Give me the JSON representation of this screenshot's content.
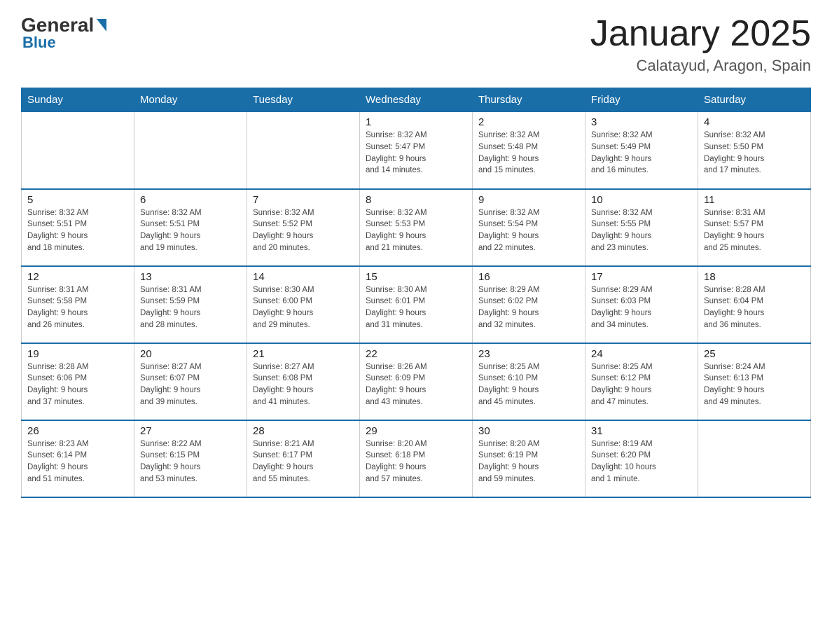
{
  "logo": {
    "general_text": "General",
    "blue_text": "Blue"
  },
  "title": "January 2025",
  "location": "Calatayud, Aragon, Spain",
  "days_of_week": [
    "Sunday",
    "Monday",
    "Tuesday",
    "Wednesday",
    "Thursday",
    "Friday",
    "Saturday"
  ],
  "weeks": [
    [
      {
        "day": "",
        "info": ""
      },
      {
        "day": "",
        "info": ""
      },
      {
        "day": "",
        "info": ""
      },
      {
        "day": "1",
        "info": "Sunrise: 8:32 AM\nSunset: 5:47 PM\nDaylight: 9 hours\nand 14 minutes."
      },
      {
        "day": "2",
        "info": "Sunrise: 8:32 AM\nSunset: 5:48 PM\nDaylight: 9 hours\nand 15 minutes."
      },
      {
        "day": "3",
        "info": "Sunrise: 8:32 AM\nSunset: 5:49 PM\nDaylight: 9 hours\nand 16 minutes."
      },
      {
        "day": "4",
        "info": "Sunrise: 8:32 AM\nSunset: 5:50 PM\nDaylight: 9 hours\nand 17 minutes."
      }
    ],
    [
      {
        "day": "5",
        "info": "Sunrise: 8:32 AM\nSunset: 5:51 PM\nDaylight: 9 hours\nand 18 minutes."
      },
      {
        "day": "6",
        "info": "Sunrise: 8:32 AM\nSunset: 5:51 PM\nDaylight: 9 hours\nand 19 minutes."
      },
      {
        "day": "7",
        "info": "Sunrise: 8:32 AM\nSunset: 5:52 PM\nDaylight: 9 hours\nand 20 minutes."
      },
      {
        "day": "8",
        "info": "Sunrise: 8:32 AM\nSunset: 5:53 PM\nDaylight: 9 hours\nand 21 minutes."
      },
      {
        "day": "9",
        "info": "Sunrise: 8:32 AM\nSunset: 5:54 PM\nDaylight: 9 hours\nand 22 minutes."
      },
      {
        "day": "10",
        "info": "Sunrise: 8:32 AM\nSunset: 5:55 PM\nDaylight: 9 hours\nand 23 minutes."
      },
      {
        "day": "11",
        "info": "Sunrise: 8:31 AM\nSunset: 5:57 PM\nDaylight: 9 hours\nand 25 minutes."
      }
    ],
    [
      {
        "day": "12",
        "info": "Sunrise: 8:31 AM\nSunset: 5:58 PM\nDaylight: 9 hours\nand 26 minutes."
      },
      {
        "day": "13",
        "info": "Sunrise: 8:31 AM\nSunset: 5:59 PM\nDaylight: 9 hours\nand 28 minutes."
      },
      {
        "day": "14",
        "info": "Sunrise: 8:30 AM\nSunset: 6:00 PM\nDaylight: 9 hours\nand 29 minutes."
      },
      {
        "day": "15",
        "info": "Sunrise: 8:30 AM\nSunset: 6:01 PM\nDaylight: 9 hours\nand 31 minutes."
      },
      {
        "day": "16",
        "info": "Sunrise: 8:29 AM\nSunset: 6:02 PM\nDaylight: 9 hours\nand 32 minutes."
      },
      {
        "day": "17",
        "info": "Sunrise: 8:29 AM\nSunset: 6:03 PM\nDaylight: 9 hours\nand 34 minutes."
      },
      {
        "day": "18",
        "info": "Sunrise: 8:28 AM\nSunset: 6:04 PM\nDaylight: 9 hours\nand 36 minutes."
      }
    ],
    [
      {
        "day": "19",
        "info": "Sunrise: 8:28 AM\nSunset: 6:06 PM\nDaylight: 9 hours\nand 37 minutes."
      },
      {
        "day": "20",
        "info": "Sunrise: 8:27 AM\nSunset: 6:07 PM\nDaylight: 9 hours\nand 39 minutes."
      },
      {
        "day": "21",
        "info": "Sunrise: 8:27 AM\nSunset: 6:08 PM\nDaylight: 9 hours\nand 41 minutes."
      },
      {
        "day": "22",
        "info": "Sunrise: 8:26 AM\nSunset: 6:09 PM\nDaylight: 9 hours\nand 43 minutes."
      },
      {
        "day": "23",
        "info": "Sunrise: 8:25 AM\nSunset: 6:10 PM\nDaylight: 9 hours\nand 45 minutes."
      },
      {
        "day": "24",
        "info": "Sunrise: 8:25 AM\nSunset: 6:12 PM\nDaylight: 9 hours\nand 47 minutes."
      },
      {
        "day": "25",
        "info": "Sunrise: 8:24 AM\nSunset: 6:13 PM\nDaylight: 9 hours\nand 49 minutes."
      }
    ],
    [
      {
        "day": "26",
        "info": "Sunrise: 8:23 AM\nSunset: 6:14 PM\nDaylight: 9 hours\nand 51 minutes."
      },
      {
        "day": "27",
        "info": "Sunrise: 8:22 AM\nSunset: 6:15 PM\nDaylight: 9 hours\nand 53 minutes."
      },
      {
        "day": "28",
        "info": "Sunrise: 8:21 AM\nSunset: 6:17 PM\nDaylight: 9 hours\nand 55 minutes."
      },
      {
        "day": "29",
        "info": "Sunrise: 8:20 AM\nSunset: 6:18 PM\nDaylight: 9 hours\nand 57 minutes."
      },
      {
        "day": "30",
        "info": "Sunrise: 8:20 AM\nSunset: 6:19 PM\nDaylight: 9 hours\nand 59 minutes."
      },
      {
        "day": "31",
        "info": "Sunrise: 8:19 AM\nSunset: 6:20 PM\nDaylight: 10 hours\nand 1 minute."
      },
      {
        "day": "",
        "info": ""
      }
    ]
  ]
}
